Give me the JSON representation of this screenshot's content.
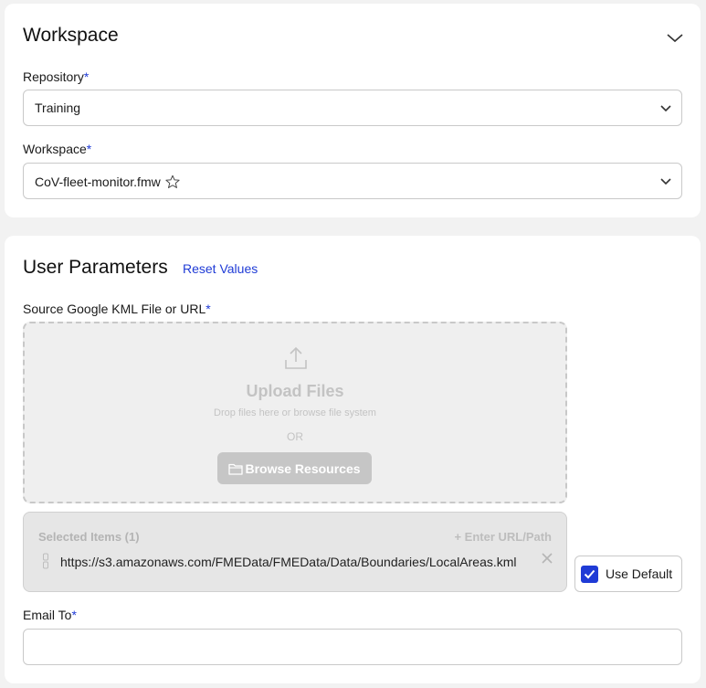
{
  "workspace_section": {
    "title": "Workspace",
    "repository": {
      "label": "Repository",
      "required_mark": "*",
      "value": "Training"
    },
    "workspace": {
      "label": "Workspace",
      "required_mark": "*",
      "value": "CoV-fleet-monitor.fmw"
    }
  },
  "user_parameters": {
    "title": "User Parameters",
    "reset_label": "Reset Values",
    "source": {
      "label": "Source Google KML File or URL",
      "required_mark": "*",
      "upload_title": "Upload Files",
      "upload_hint": "Drop files here or browse file system",
      "or_text": "OR",
      "browse_label": "Browse Resources",
      "selected_label": "Selected Items (1)",
      "enter_url_label": "+ Enter URL/Path",
      "items": [
        {
          "url": "https://s3.amazonaws.com/FMEData/FMEData/Data/Boundaries/LocalAreas.kml"
        }
      ],
      "use_default_label": "Use Default",
      "use_default_checked": true
    },
    "email": {
      "label": "Email To",
      "required_mark": "*",
      "value": "",
      "placeholder": ""
    }
  },
  "colors": {
    "accent": "#1f3bd6",
    "background": "#f2f2f2",
    "card": "#ffffff"
  },
  "icons": {
    "collapse": "chevron-down-icon",
    "select": "chevron-down-icon",
    "favorite": "star-outline-icon",
    "upload": "upload-icon",
    "folder": "folder-icon",
    "drag": "drag-handle-icon",
    "remove": "close-icon",
    "check": "checkmark-icon"
  }
}
